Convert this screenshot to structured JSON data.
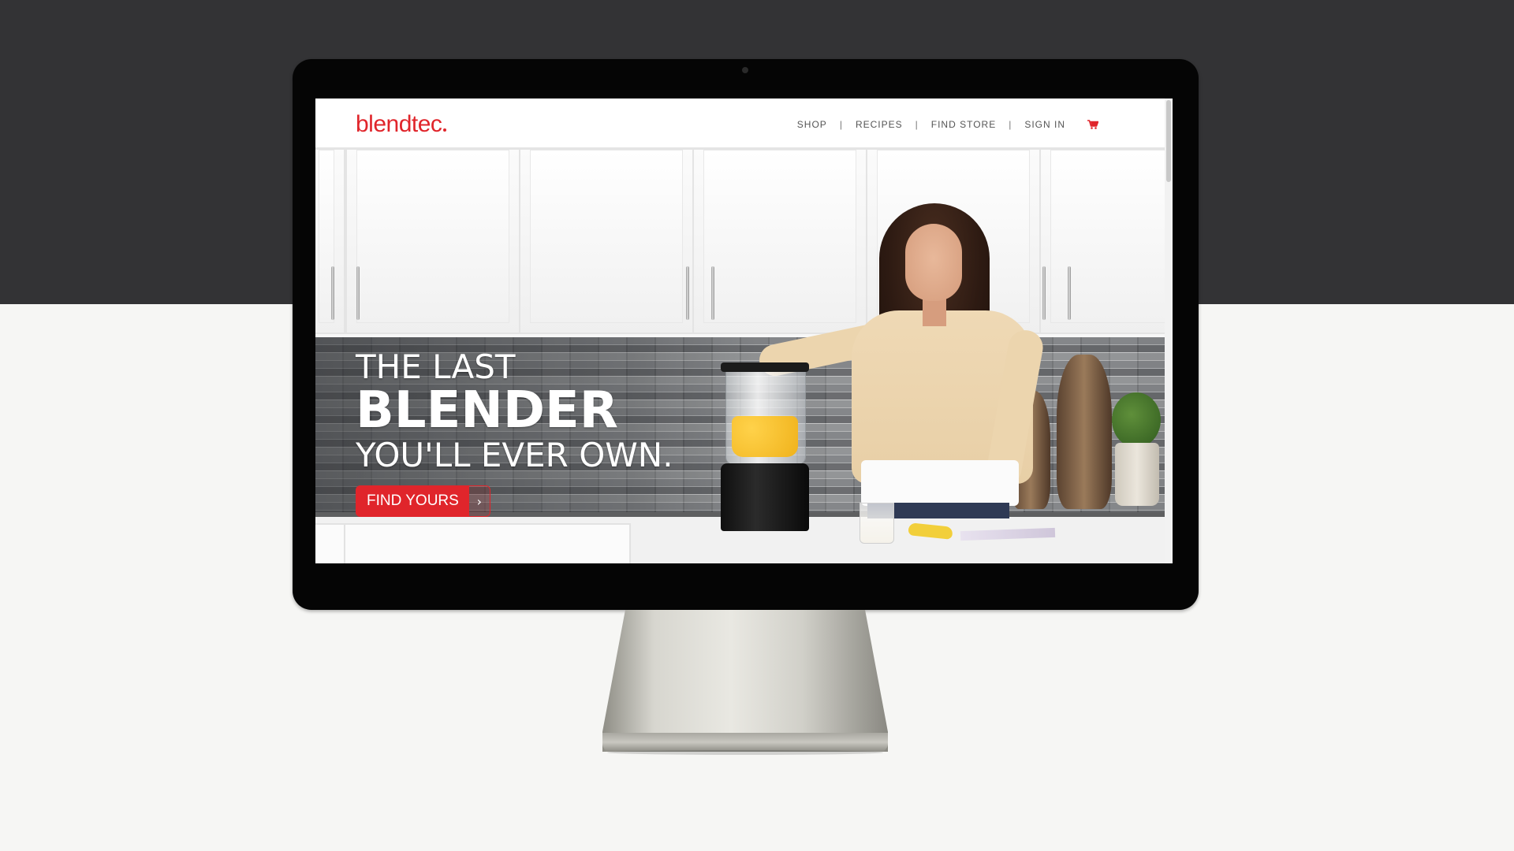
{
  "site": {
    "logo_text": "blendtec",
    "brand_color": "#e0252b"
  },
  "nav": {
    "items": [
      {
        "label": "SHOP"
      },
      {
        "label": "RECIPES"
      },
      {
        "label": "FIND STORE"
      },
      {
        "label": "SIGN IN"
      }
    ],
    "separator": "|",
    "cart_icon": "shopping-cart-icon"
  },
  "hero": {
    "line1": "THE LAST",
    "line2": "BLENDER",
    "line3": "YOU'LL EVER OWN.",
    "cta_label": "FIND YOURS",
    "cta_icon": "chevron-right-icon",
    "cta_arrow_glyph": "›"
  },
  "colors": {
    "page_background": "#f6f6f4",
    "top_band": "#333335",
    "monitor_bezel": "#050505"
  }
}
